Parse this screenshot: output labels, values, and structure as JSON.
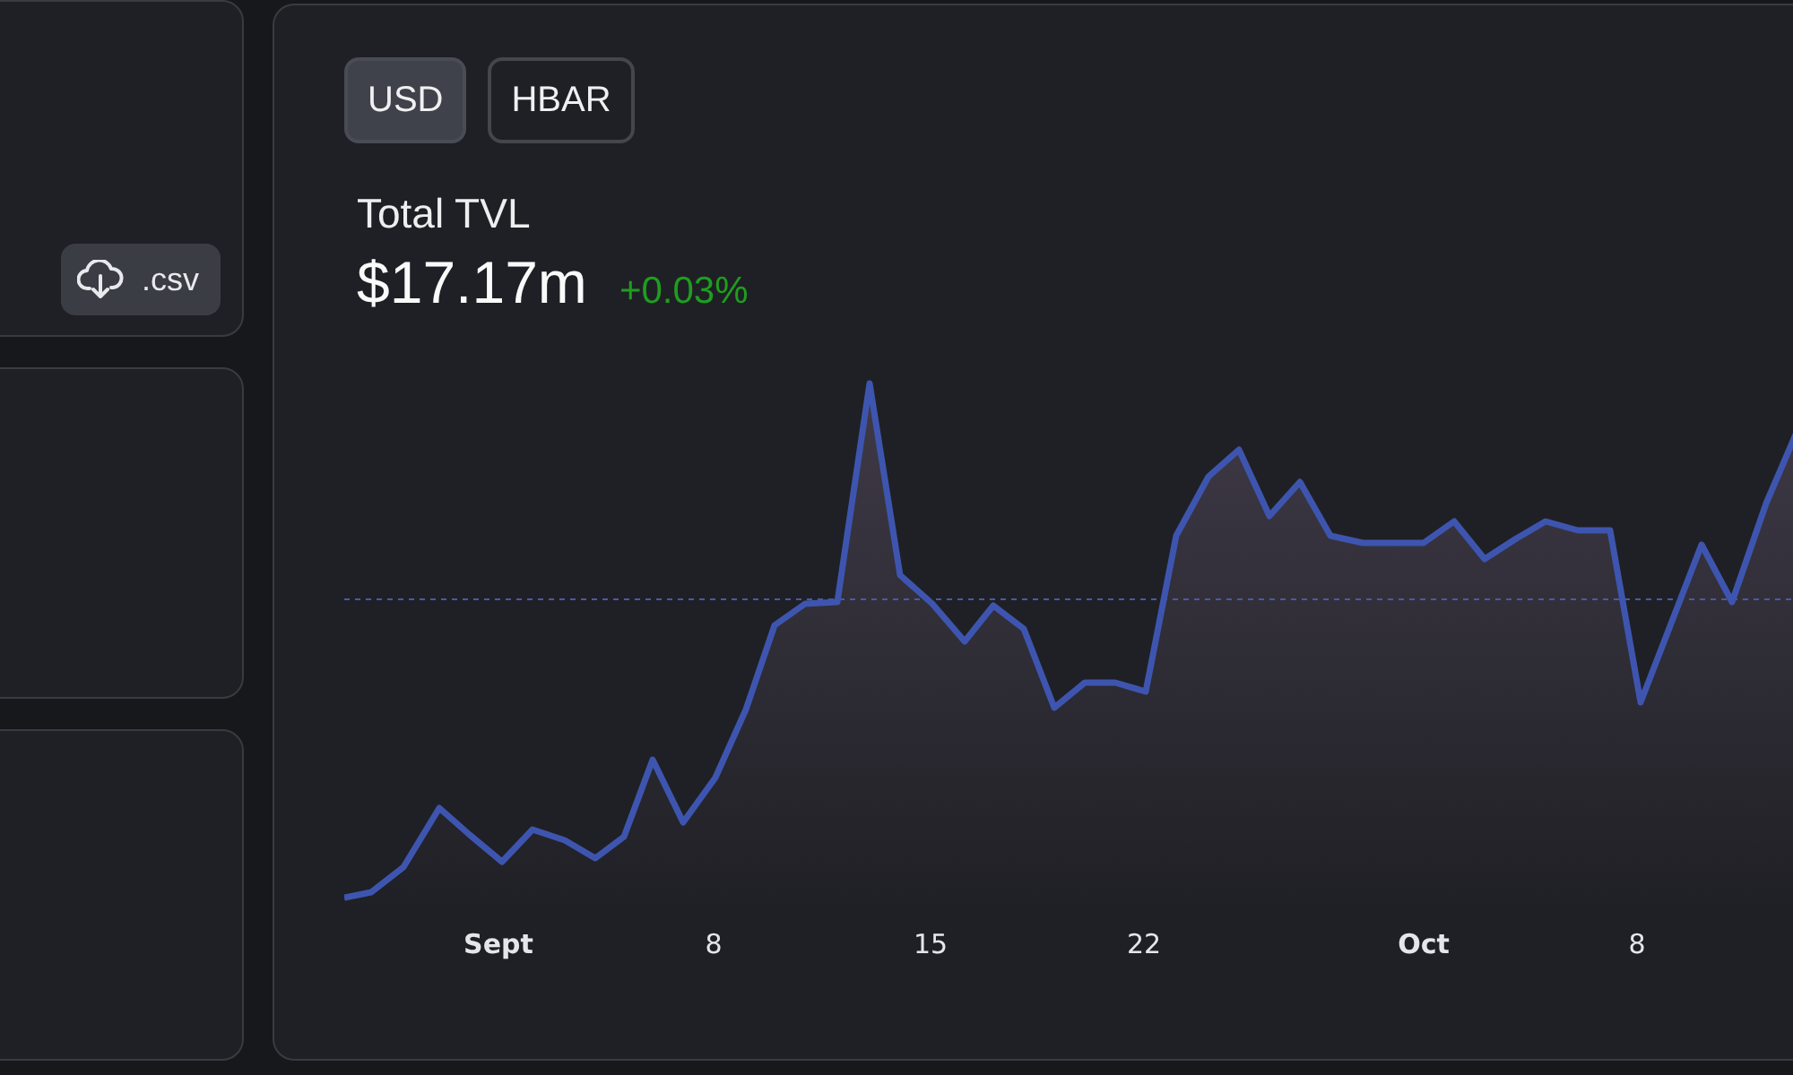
{
  "side_card": {
    "csv_button": ".csv"
  },
  "currency_toggle": [
    {
      "label": "USD",
      "selected": true
    },
    {
      "label": "HBAR",
      "selected": false
    }
  ],
  "metric": {
    "label": "Total TVL",
    "value": "$17.17m",
    "change": "+0.03%"
  },
  "chart": {
    "x_labels": [
      "Sept",
      "8",
      "15",
      "22",
      "Oct",
      "8"
    ]
  }
}
